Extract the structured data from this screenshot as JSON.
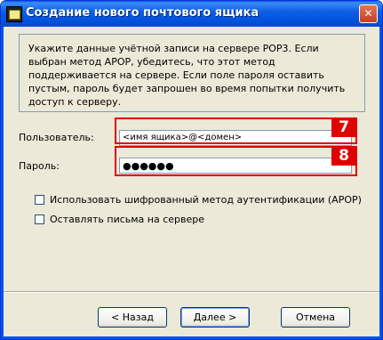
{
  "window": {
    "title": "Создание нового почтового ящика",
    "close_glyph": "✕"
  },
  "description": "Укажите данные учётной записи на сервере POP3. Если выбран метод APOP, убедитесь, что этот метод поддерживается на сервере. Если поле пароля оставить пустым, пароль будет запрошен во время попытки получить доступ к серверу.",
  "form": {
    "user_label": "Пользователь:",
    "user_value": "<имя ящика>@<домен>",
    "password_label": "Пароль:",
    "password_value": "●●●●●●",
    "callouts": [
      "7",
      "8"
    ],
    "checkboxes": [
      {
        "label": "Использовать шифрованный метод аутентификации (APOP)",
        "checked": false
      },
      {
        "label": "Оставлять письма на сервере",
        "checked": false
      }
    ]
  },
  "buttons": {
    "back": "< Назад",
    "next": "Далее >",
    "cancel": "Отмена"
  },
  "colors": {
    "titlebar": "#0055e5",
    "callout": "#e00000",
    "dialog_bg": "#ece9d8"
  }
}
